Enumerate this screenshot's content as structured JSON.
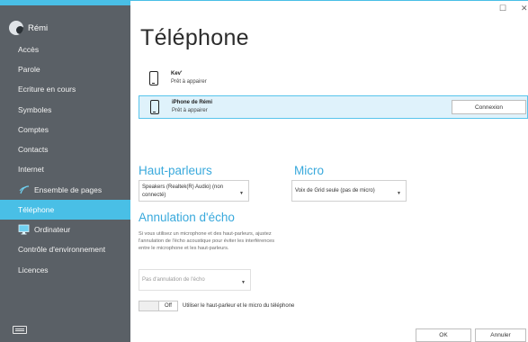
{
  "window": {
    "maximize_glyph": "☐",
    "close_glyph": "✕"
  },
  "sidebar": {
    "user_name": "Rémi",
    "items": [
      {
        "label": "Accès"
      },
      {
        "label": "Parole"
      },
      {
        "label": "Ecriture en cours"
      },
      {
        "label": "Symboles"
      },
      {
        "label": "Comptes"
      },
      {
        "label": "Contacts"
      },
      {
        "label": "Internet"
      },
      {
        "label": "Ensemble de pages",
        "icon": "grid-wave-icon"
      },
      {
        "label": "Téléphone",
        "active": true
      },
      {
        "label": "Ordinateur",
        "icon": "computer-icon"
      },
      {
        "label": "Contrôle d'environnement"
      },
      {
        "label": "Licences"
      }
    ]
  },
  "main": {
    "title": "Téléphone",
    "devices": [
      {
        "name": "Kev'",
        "status": "Prêt à appairer"
      },
      {
        "name": "iPhone de Rémi",
        "status": "Prêt à appairer",
        "selected": true,
        "action_label": "Connexion"
      }
    ],
    "speakers": {
      "heading": "Haut-parleurs",
      "selected_line1": "Speakers (Realtek(R) Audio) (non",
      "selected_line2": "connecté)"
    },
    "micro": {
      "heading": "Micro",
      "selected": "Voix de Grid seule (pas de micro)"
    },
    "echo": {
      "heading": "Annulation d'écho",
      "description": "Si vous utilisez un microphone et des haut-parleurs, ajustez l'annulation de l'écho acoustique pour éviter les interférences entre le microphone et les haut-parleurs.",
      "selected": "Pas d'annulation de l'écho"
    },
    "phone_speaker_toggle": {
      "state": "Off",
      "label": "Utiliser le haut-parleur et le micro du téléphone"
    },
    "ok_label": "OK",
    "cancel_label": "Annuler"
  },
  "colors": {
    "accent": "#49bfe6",
    "sidebar": "#5a6066",
    "heading": "#39a9dc",
    "selected_row": "#dff2fb"
  }
}
